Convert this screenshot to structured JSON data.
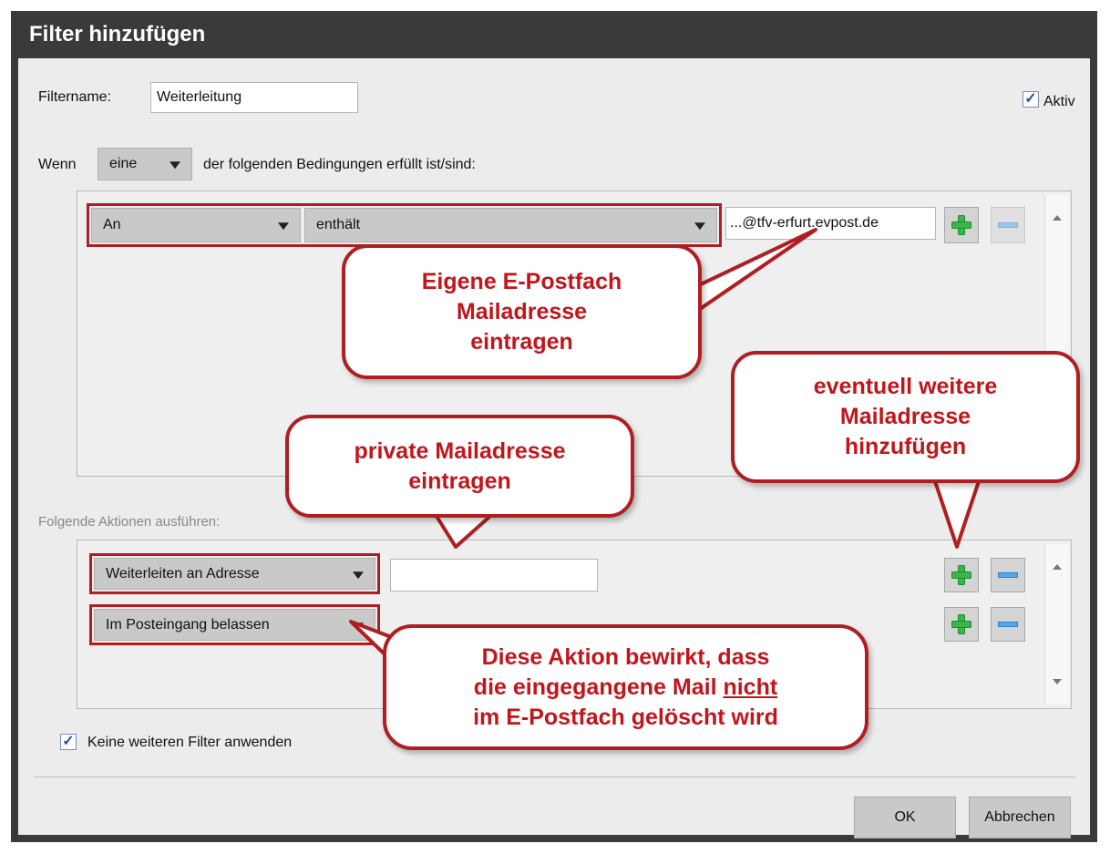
{
  "dialog": {
    "title": "Filter hinzufügen"
  },
  "filtername": {
    "label": "Filtername:",
    "value": "Weiterleitung"
  },
  "aktiv": {
    "label": "Aktiv",
    "checked": true
  },
  "condition_line": {
    "prefix": "Wenn",
    "match_select": "eine",
    "suffix": "der folgenden Bedingungen erfüllt ist/sind:"
  },
  "conditions": [
    {
      "field": "An",
      "operator": "enthält",
      "value": "...@tfv-erfurt.evpost.de"
    }
  ],
  "actions_label": "Folgende Aktionen ausführen:",
  "actions": [
    {
      "action": "Weiterleiten an Adresse",
      "value": ""
    },
    {
      "action": "Im Posteingang belassen"
    }
  ],
  "keine_weiteren": {
    "label": "Keine weiteren Filter anwenden",
    "checked": true
  },
  "buttons": {
    "ok": "OK",
    "cancel": "Abbrechen"
  },
  "callouts": {
    "own_address": [
      "Eigene E-Postfach",
      "Mailadresse",
      "eintragen"
    ],
    "more_addresses": [
      "eventuell weitere",
      "Mailadresse",
      "hinzufügen"
    ],
    "private_address": [
      "private Mailadresse",
      "eintragen"
    ],
    "keep_note": {
      "line1": "Diese Aktion bewirkt, dass",
      "line2_pre": "die eingegangene Mail ",
      "line2_emph": "nicht",
      "line3": "im E-Postfach gelöscht wird"
    }
  },
  "colors": {
    "titlebar": "#3a3a3a",
    "accent_red": "#b01e22",
    "callout_text": "#c0161c",
    "plus": "#39b54a",
    "minus": "#55a9ea"
  },
  "icons": [
    "plus-icon",
    "minus-icon",
    "dropdown-arrow-icon",
    "checkbox-check-icon",
    "scroll-up-icon",
    "scroll-down-icon"
  ]
}
